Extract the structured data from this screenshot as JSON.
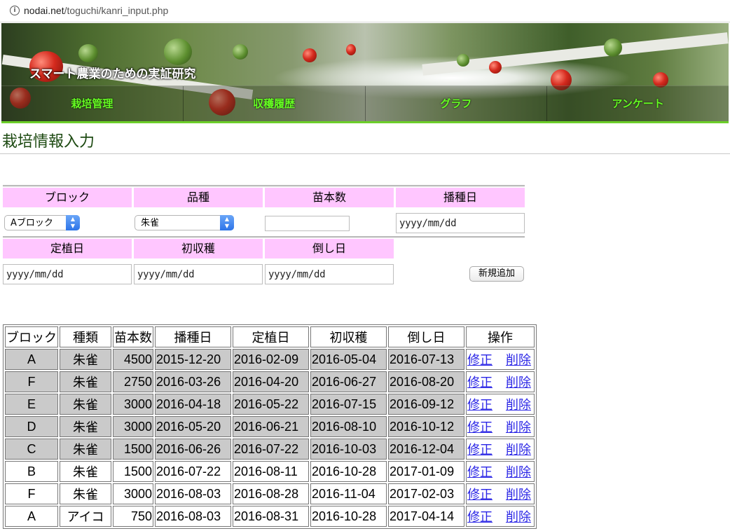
{
  "browser": {
    "url_host": "nodai.net",
    "url_path": "/toguchi/kanri_input.php",
    "info_icon": "info-icon"
  },
  "banner": {
    "site_title": "スマート農業のための実証研究",
    "nav": [
      "栽培管理",
      "収穫履歴",
      "グラフ",
      "アンケート"
    ],
    "nav_color": "#66ff22"
  },
  "page_title": "栽培情報入力",
  "form": {
    "labels": {
      "block": "ブロック",
      "variety": "品種",
      "seedlings": "苗本数",
      "sowing": "播種日",
      "planting": "定植日",
      "first_harvest": "初収穫",
      "knockdown": "倒し日"
    },
    "block_select": "Aブロック",
    "variety_select": "朱雀",
    "seedlings_value": "",
    "sowing_placeholder": "yyyy/mm/dd",
    "planting_placeholder": "yyyy/mm/dd",
    "first_harvest_placeholder": "yyyy/mm/dd",
    "knockdown_placeholder": "yyyy/mm/dd",
    "add_button": "新規追加",
    "header_color": "#ffc6ff"
  },
  "table": {
    "headers": [
      "ブロック",
      "種類",
      "苗本数",
      "播種日",
      "定植日",
      "初収穫",
      "倒し日",
      "操作"
    ],
    "edit_label": "修正",
    "delete_label": "削除",
    "rows": [
      {
        "block": "A",
        "variety": "朱雀",
        "count": "4500",
        "sowing": "2015-12-20",
        "planting": "2016-02-09",
        "first": "2016-05-04",
        "knockdown": "2016-07-13",
        "shaded": true
      },
      {
        "block": "F",
        "variety": "朱雀",
        "count": "2750",
        "sowing": "2016-03-26",
        "planting": "2016-04-20",
        "first": "2016-06-27",
        "knockdown": "2016-08-20",
        "shaded": true
      },
      {
        "block": "E",
        "variety": "朱雀",
        "count": "3000",
        "sowing": "2016-04-18",
        "planting": "2016-05-22",
        "first": "2016-07-15",
        "knockdown": "2016-09-12",
        "shaded": true
      },
      {
        "block": "D",
        "variety": "朱雀",
        "count": "3000",
        "sowing": "2016-05-20",
        "planting": "2016-06-21",
        "first": "2016-08-10",
        "knockdown": "2016-10-12",
        "shaded": true
      },
      {
        "block": "C",
        "variety": "朱雀",
        "count": "1500",
        "sowing": "2016-06-26",
        "planting": "2016-07-22",
        "first": "2016-10-03",
        "knockdown": "2016-12-04",
        "shaded": true
      },
      {
        "block": "B",
        "variety": "朱雀",
        "count": "1500",
        "sowing": "2016-07-22",
        "planting": "2016-08-11",
        "first": "2016-10-28",
        "knockdown": "2017-01-09",
        "shaded": false
      },
      {
        "block": "F",
        "variety": "朱雀",
        "count": "3000",
        "sowing": "2016-08-03",
        "planting": "2016-08-28",
        "first": "2016-11-04",
        "knockdown": "2017-02-03",
        "shaded": false
      },
      {
        "block": "A",
        "variety": "アイコ",
        "count": "750",
        "sowing": "2016-08-03",
        "planting": "2016-08-31",
        "first": "2016-10-28",
        "knockdown": "2017-04-14",
        "shaded": false
      }
    ]
  }
}
